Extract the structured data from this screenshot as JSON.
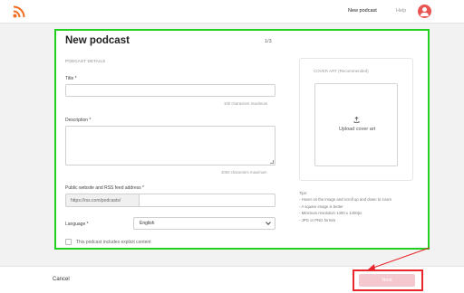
{
  "header": {
    "logo_icon": "rss-icon",
    "nav_new_podcast": "New podcast",
    "nav_help": "Help",
    "avatar_icon": "user-icon",
    "brand_color": "#f26c1f"
  },
  "form": {
    "title": "New podcast",
    "step": "1/3",
    "section_label": "PODCAST DETAILS",
    "title_field": {
      "label": "Title *",
      "value": "",
      "hint": "100 characters maximum"
    },
    "description_field": {
      "label": "Description *",
      "value": "",
      "hint": "4000 characters maximum"
    },
    "url_field": {
      "label": "Public website and RSS feed address *",
      "prefix": "https://rss.com/podcasts/",
      "value": ""
    },
    "language_field": {
      "label": "Language *",
      "selected": "English"
    },
    "explicit_checkbox": {
      "label": "This podcast includes explicit content",
      "checked": false
    }
  },
  "cover_art": {
    "label": "COVER ART  (Recommended)",
    "upload_icon": "upload-icon",
    "upload_text": "Upload cover art",
    "tips_title": "Tips:",
    "tips": [
      "- Hover on the image and scroll up and down to zoom",
      "- A square image is better",
      "- Minimum resolution 1400 x 1400px",
      "- JPG or PNG format"
    ]
  },
  "footer": {
    "cancel_label": "Cancel",
    "next_label": "Next"
  },
  "colors": {
    "highlight_green": "#22d022",
    "highlight_red": "#e8262b",
    "next_button_disabled": "#f5c8cf",
    "avatar": "#e85552"
  }
}
